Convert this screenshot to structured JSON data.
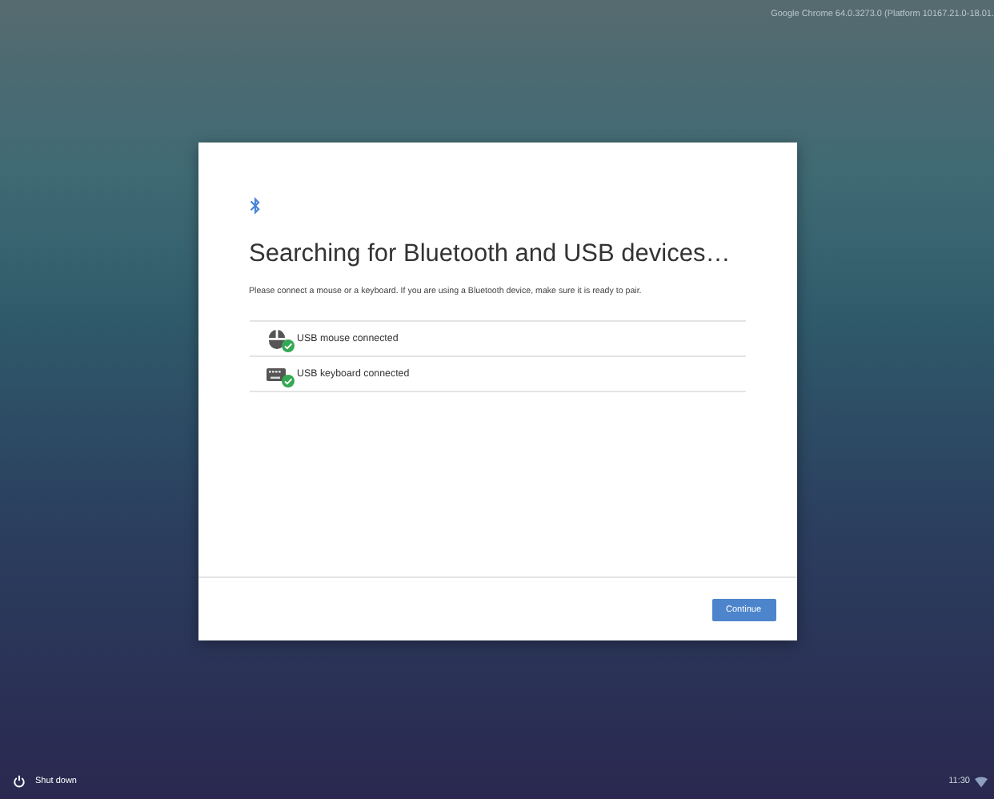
{
  "version_label": "Google Chrome 64.0.3273.0 (Platform 10167.21.0-18.01.",
  "dialog": {
    "title": "Searching for Bluetooth and USB devices…",
    "description": "Please connect a mouse or a keyboard. If you are using a Bluetooth device, make sure it is ready to pair.",
    "devices": [
      {
        "kind": "mouse",
        "label": "USB mouse connected",
        "connected": true
      },
      {
        "kind": "keyboard",
        "label": "USB keyboard connected",
        "connected": true
      }
    ],
    "continue_button": "Continue"
  },
  "shelf": {
    "shutdown": "Shut down",
    "time": "11:30"
  }
}
